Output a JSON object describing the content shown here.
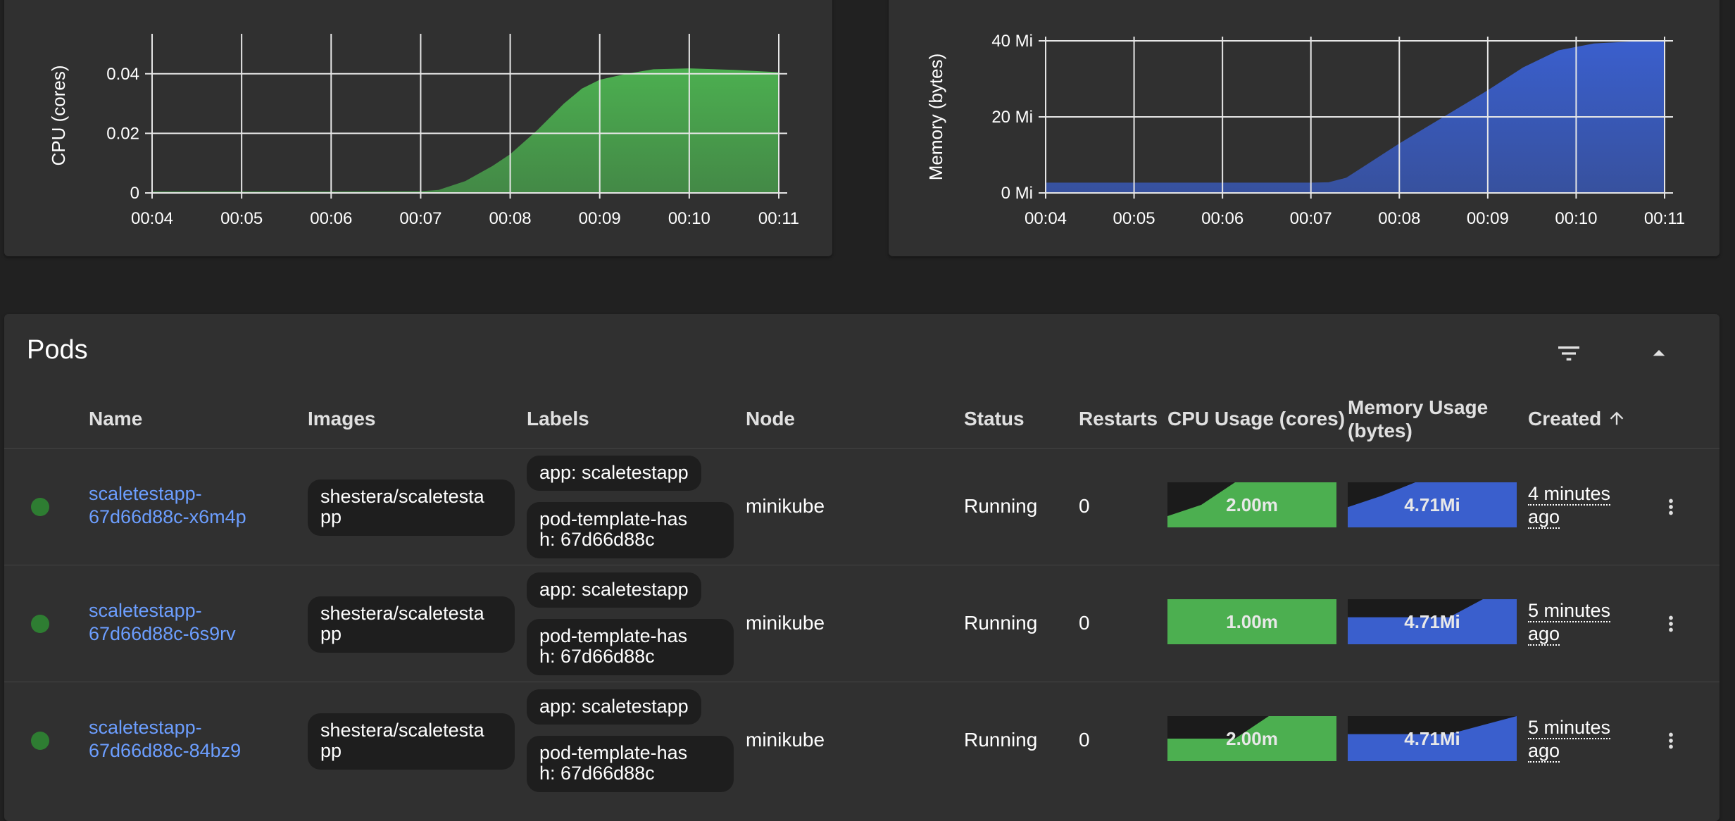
{
  "colors": {
    "cpu_green": "#4caf50",
    "memory_blue": "#3a5fcd",
    "link_blue": "#6c9eff",
    "status_green": "#2e7d32",
    "card_bg": "#303030",
    "page_bg": "#212121"
  },
  "cpu_chart": {
    "chart_data": {
      "type": "area",
      "ylabel": "CPU (cores)",
      "x_ticks": [
        "00:04",
        "00:05",
        "00:06",
        "00:07",
        "00:08",
        "00:09",
        "00:10",
        "00:11"
      ],
      "y_ticks": [
        "0",
        "0.02",
        "0.04"
      ],
      "ylim": [
        0,
        0.052
      ],
      "grid": true,
      "color": "#4caf50",
      "x": [
        4,
        5,
        6,
        7,
        7.2,
        7.5,
        7.8,
        8.0,
        8.3,
        8.6,
        8.8,
        9.0,
        9.3,
        9.6,
        10.0,
        10.5,
        11.0
      ],
      "values": [
        0.0005,
        0.0005,
        0.0005,
        0.0006,
        0.001,
        0.004,
        0.009,
        0.013,
        0.021,
        0.03,
        0.035,
        0.038,
        0.04,
        0.0415,
        0.0418,
        0.0413,
        0.0405
      ]
    }
  },
  "memory_chart": {
    "chart_data": {
      "type": "area",
      "ylabel": "Memory (bytes)",
      "x_ticks": [
        "00:04",
        "00:05",
        "00:06",
        "00:07",
        "00:08",
        "00:09",
        "00:10",
        "00:11"
      ],
      "y_ticks": [
        "0 Mi",
        "20 Mi",
        "40 Mi"
      ],
      "ylim": [
        0,
        40
      ],
      "grid": true,
      "color": "#3a5fcd",
      "x": [
        4,
        5,
        6,
        7,
        7.2,
        7.4,
        7.6,
        8.0,
        8.5,
        9.0,
        9.4,
        9.8,
        10.2,
        10.6,
        11.0
      ],
      "values": [
        2.7,
        2.7,
        2.7,
        2.7,
        2.8,
        4,
        7,
        13,
        20,
        27,
        33,
        37.5,
        39.3,
        39.8,
        40
      ]
    }
  },
  "pods": {
    "title": "Pods",
    "filter_icon": "filter-list-icon",
    "collapse_icon": "expand-less-icon",
    "headers": {
      "name": "Name",
      "images": "Images",
      "labels": "Labels",
      "node": "Node",
      "status": "Status",
      "restarts": "Restarts",
      "cpu": "CPU Usage (cores)",
      "memory_line1": "Memory Usage",
      "memory_line2": "(bytes)",
      "created": "Created",
      "sort_icon": "arrow-upward-icon"
    },
    "rows": [
      {
        "name_line1": "scaletestapp-",
        "name_line2": "67d66d88c-x6m4p",
        "image_line1": "shestera/scaletesta",
        "image_line2": "pp",
        "label1": "app: scaletestapp",
        "label2_line1": "pod-template-has",
        "label2_line2": "h: 67d66d88c",
        "node": "minikube",
        "status": "Running",
        "restarts": "0",
        "cpu": "2.00m",
        "memory": "4.71Mi",
        "created_line1": "4 minutes",
        "created_line2": "ago",
        "cpu_spark": [
          0.25,
          0.5,
          1.0,
          1.0,
          1.0,
          1.0
        ],
        "mem_spark": [
          0.45,
          0.7,
          1.0,
          1.0,
          1.0,
          1.0
        ]
      },
      {
        "name_line1": "scaletestapp-",
        "name_line2": "67d66d88c-6s9rv",
        "image_line1": "shestera/scaletesta",
        "image_line2": "pp",
        "label1": "app: scaletestapp",
        "label2_line1": "pod-template-has",
        "label2_line2": "h: 67d66d88c",
        "node": "minikube",
        "status": "Running",
        "restarts": "0",
        "cpu": "1.00m",
        "memory": "4.71Mi",
        "created_line1": "5 minutes",
        "created_line2": "ago",
        "cpu_spark": [
          1.0,
          1.0,
          1.0,
          1.0,
          1.0,
          1.0
        ],
        "mem_spark": [
          0.6,
          0.6,
          0.6,
          0.6,
          1.0,
          1.0
        ]
      },
      {
        "name_line1": "scaletestapp-",
        "name_line2": "67d66d88c-84bz9",
        "image_line1": "shestera/scaletesta",
        "image_line2": "pp",
        "label1": "app: scaletestapp",
        "label2_line1": "pod-template-has",
        "label2_line2": "h: 67d66d88c",
        "node": "minikube",
        "status": "Running",
        "restarts": "0",
        "cpu": "2.00m",
        "memory": "4.71Mi",
        "created_line1": "5 minutes",
        "created_line2": "ago",
        "cpu_spark": [
          0.5,
          0.5,
          0.5,
          1.0,
          1.0,
          1.0
        ],
        "mem_spark": [
          0.6,
          0.6,
          0.6,
          0.6,
          0.8,
          1.0
        ]
      }
    ]
  }
}
